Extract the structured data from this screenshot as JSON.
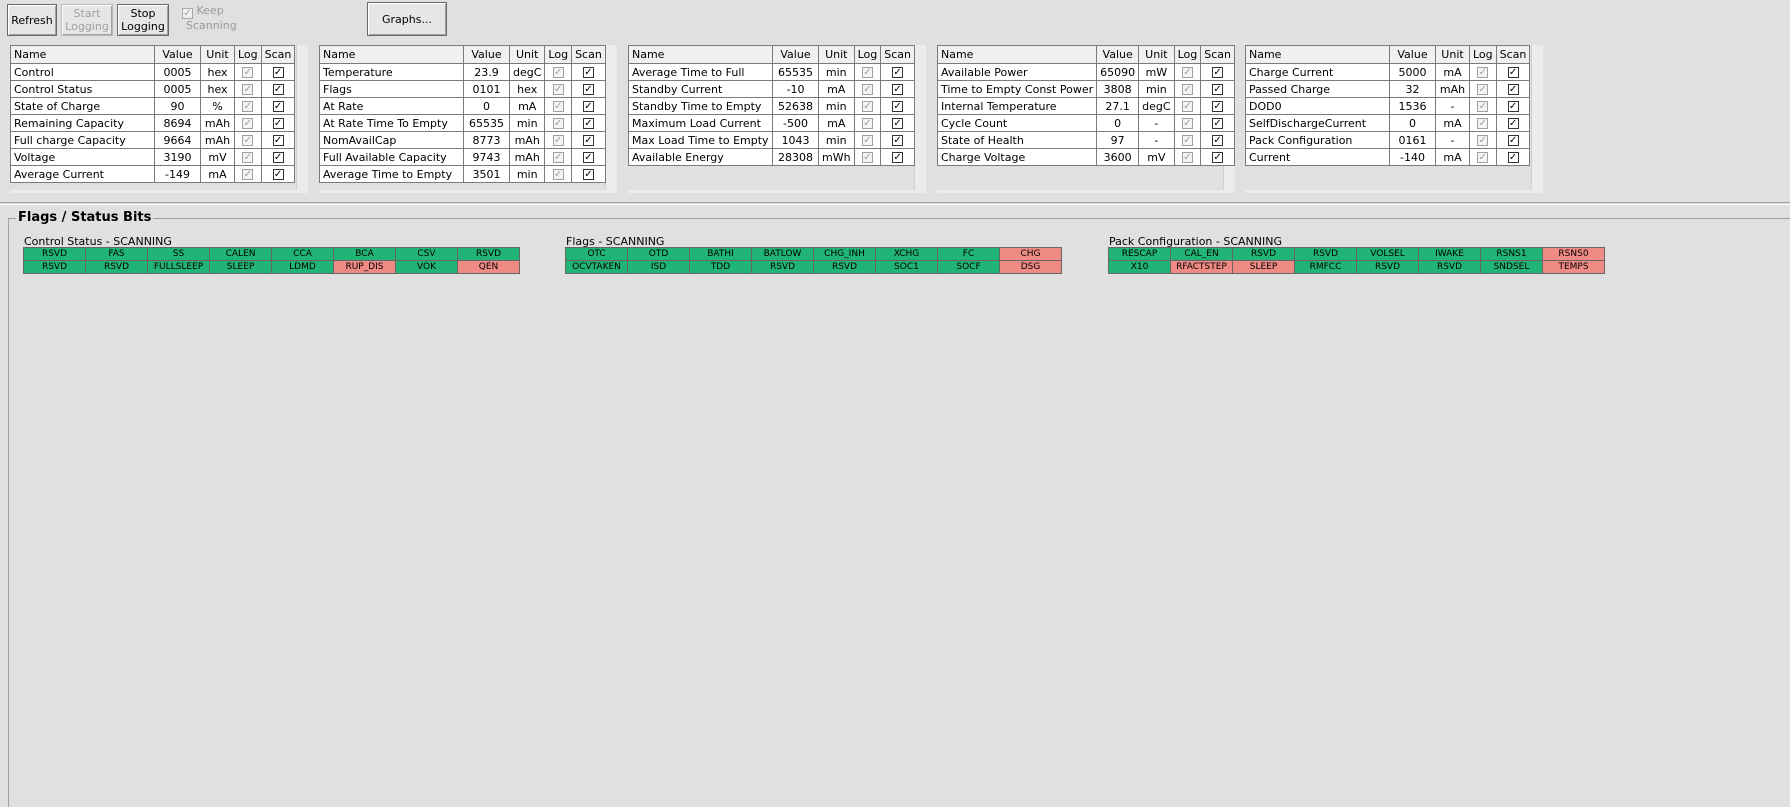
{
  "toolbar": {
    "refresh": "Refresh",
    "start_logging": "Start\nLogging",
    "stop_logging": "Stop\nLogging",
    "keep_label": "Keep",
    "keep_label2": "Scanning",
    "graphs": "Graphs..."
  },
  "columns": [
    "Name",
    "Value",
    "Unit",
    "Log",
    "Scan"
  ],
  "panels": [
    {
      "rows": [
        {
          "name": "Control",
          "value": "0005",
          "unit": "hex"
        },
        {
          "name": "Control Status",
          "value": "0005",
          "unit": "hex"
        },
        {
          "name": "State of Charge",
          "value": "90",
          "unit": "%"
        },
        {
          "name": "Remaining Capacity",
          "value": "8694",
          "unit": "mAh"
        },
        {
          "name": "Full charge Capacity",
          "value": "9664",
          "unit": "mAh"
        },
        {
          "name": "Voltage",
          "value": "3190",
          "unit": "mV"
        },
        {
          "name": "Average Current",
          "value": "-149",
          "unit": "mA"
        }
      ]
    },
    {
      "rows": [
        {
          "name": "Temperature",
          "value": "23.9",
          "unit": "degC"
        },
        {
          "name": "Flags",
          "value": "0101",
          "unit": "hex"
        },
        {
          "name": "At Rate",
          "value": "0",
          "unit": "mA"
        },
        {
          "name": "At Rate Time To Empty",
          "value": "65535",
          "unit": "min"
        },
        {
          "name": "NomAvailCap",
          "value": "8773",
          "unit": "mAh"
        },
        {
          "name": "Full Available Capacity",
          "value": "9743",
          "unit": "mAh"
        },
        {
          "name": "Average Time to Empty",
          "value": "3501",
          "unit": "min"
        }
      ]
    },
    {
      "rows": [
        {
          "name": "Average Time to Full",
          "value": "65535",
          "unit": "min"
        },
        {
          "name": "Standby Current",
          "value": "-10",
          "unit": "mA"
        },
        {
          "name": "Standby Time to Empty",
          "value": "52638",
          "unit": "min"
        },
        {
          "name": "Maximum Load Current",
          "value": "-500",
          "unit": "mA"
        },
        {
          "name": "Max Load Time to Empty",
          "value": "1043",
          "unit": "min"
        },
        {
          "name": "Available Energy",
          "value": "28308",
          "unit": "mWh"
        }
      ]
    },
    {
      "rows": [
        {
          "name": "Available Power",
          "value": "65090",
          "unit": "mW"
        },
        {
          "name": "Time to Empty Const Power",
          "value": "3808",
          "unit": "min"
        },
        {
          "name": "Internal Temperature",
          "value": "27.1",
          "unit": "degC"
        },
        {
          "name": "Cycle Count",
          "value": "0",
          "unit": "-"
        },
        {
          "name": "State of Health",
          "value": "97",
          "unit": "-"
        },
        {
          "name": "Charge Voltage",
          "value": "3600",
          "unit": "mV"
        }
      ]
    },
    {
      "rows": [
        {
          "name": "Charge Current",
          "value": "5000",
          "unit": "mA"
        },
        {
          "name": "Passed Charge",
          "value": "32",
          "unit": "mAh"
        },
        {
          "name": "DOD0",
          "value": "1536",
          "unit": "-"
        },
        {
          "name": "SelfDischargeCurrent",
          "value": "0",
          "unit": "mA"
        },
        {
          "name": "Pack Configuration",
          "value": "0161",
          "unit": "-"
        },
        {
          "name": "Current",
          "value": "-140",
          "unit": "mA"
        }
      ]
    }
  ],
  "flags_section": {
    "title": "Flags / Status Bits",
    "groups": [
      {
        "title": "Control Status - SCANNING",
        "rows": [
          [
            {
              "t": "RSVD",
              "c": "g"
            },
            {
              "t": "FAS",
              "c": "g"
            },
            {
              "t": "SS",
              "c": "g"
            },
            {
              "t": "CALEN",
              "c": "g"
            },
            {
              "t": "CCA",
              "c": "g"
            },
            {
              "t": "BCA",
              "c": "g"
            },
            {
              "t": "CSV",
              "c": "g"
            },
            {
              "t": "RSVD",
              "c": "g"
            }
          ],
          [
            {
              "t": "RSVD",
              "c": "g"
            },
            {
              "t": "RSVD",
              "c": "g"
            },
            {
              "t": "FULLSLEEP",
              "c": "g"
            },
            {
              "t": "SLEEP",
              "c": "g"
            },
            {
              "t": "LDMD",
              "c": "g"
            },
            {
              "t": "RUP_DIS",
              "c": "r"
            },
            {
              "t": "VOK",
              "c": "g"
            },
            {
              "t": "QEN",
              "c": "r"
            }
          ]
        ]
      },
      {
        "title": "Flags - SCANNING",
        "rows": [
          [
            {
              "t": "OTC",
              "c": "g"
            },
            {
              "t": "OTD",
              "c": "g"
            },
            {
              "t": "BATHI",
              "c": "g"
            },
            {
              "t": "BATLOW",
              "c": "g"
            },
            {
              "t": "CHG_INH",
              "c": "g"
            },
            {
              "t": "XCHG",
              "c": "g"
            },
            {
              "t": "FC",
              "c": "g"
            },
            {
              "t": "CHG",
              "c": "r"
            }
          ],
          [
            {
              "t": "OCVTAKEN",
              "c": "g"
            },
            {
              "t": "ISD",
              "c": "g"
            },
            {
              "t": "TDD",
              "c": "g"
            },
            {
              "t": "RSVD",
              "c": "g"
            },
            {
              "t": "RSVD",
              "c": "g"
            },
            {
              "t": "SOC1",
              "c": "g"
            },
            {
              "t": "SOCF",
              "c": "g"
            },
            {
              "t": "DSG",
              "c": "r"
            }
          ]
        ]
      },
      {
        "title": "Pack Configuration - SCANNING",
        "rows": [
          [
            {
              "t": "RESCAP",
              "c": "g"
            },
            {
              "t": "CAL_EN",
              "c": "g"
            },
            {
              "t": "RSVD",
              "c": "g"
            },
            {
              "t": "RSVD",
              "c": "g"
            },
            {
              "t": "VOLSEL",
              "c": "g"
            },
            {
              "t": "IWAKE",
              "c": "g"
            },
            {
              "t": "RSNS1",
              "c": "g"
            },
            {
              "t": "RSNS0",
              "c": "r"
            }
          ],
          [
            {
              "t": "X10",
              "c": "g"
            },
            {
              "t": "RFACTSTEP",
              "c": "r"
            },
            {
              "t": "SLEEP",
              "c": "r"
            },
            {
              "t": "RMFCC",
              "c": "g"
            },
            {
              "t": "RSVD",
              "c": "g"
            },
            {
              "t": "RSVD",
              "c": "g"
            },
            {
              "t": "SNDSEL",
              "c": "g"
            },
            {
              "t": "TEMPS",
              "c": "r"
            }
          ]
        ]
      }
    ]
  },
  "colors": {
    "bit_set": "#20b476",
    "bit_clear": "#f08a84"
  }
}
